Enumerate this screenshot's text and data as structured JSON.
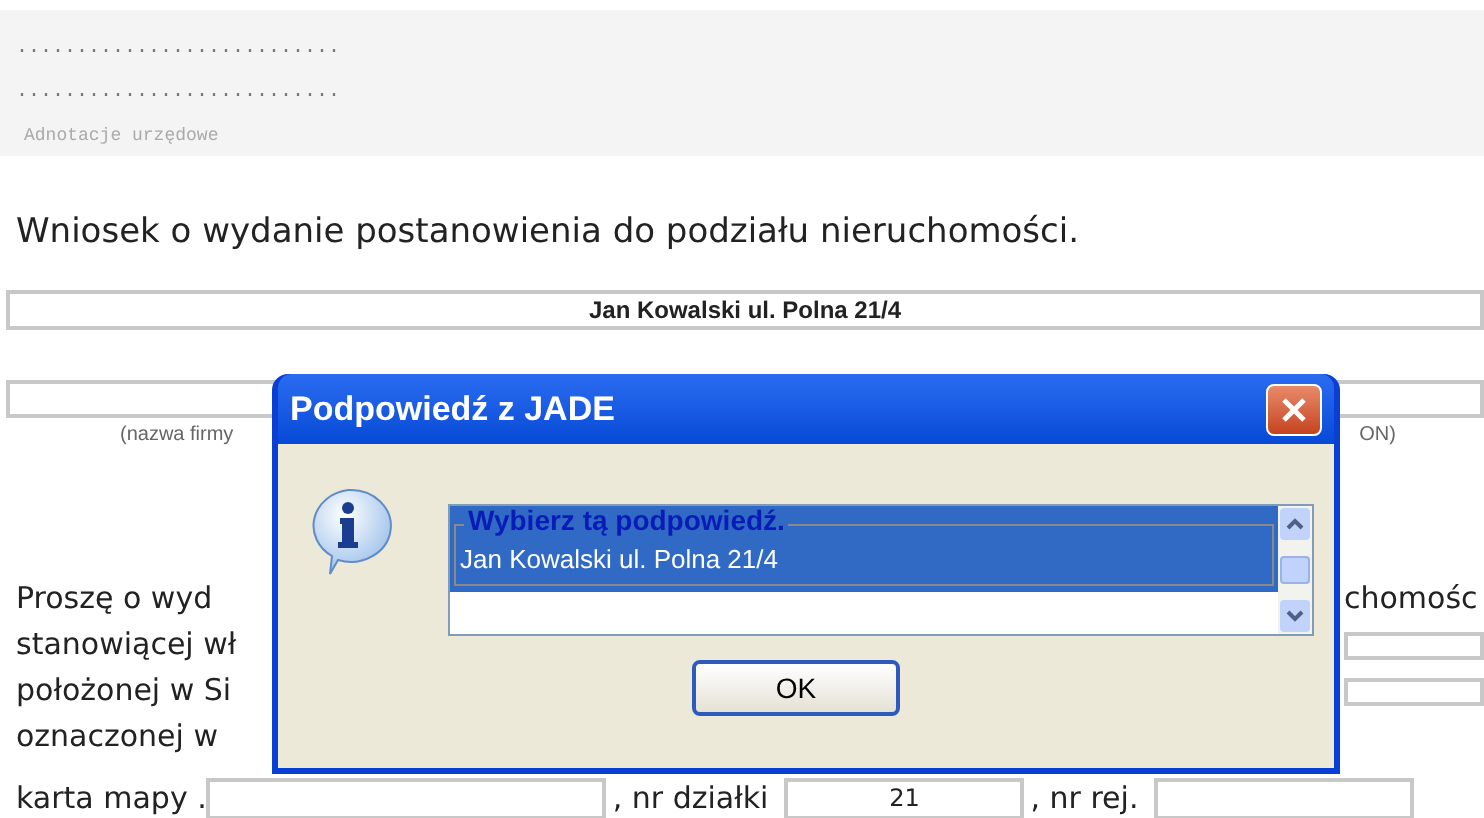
{
  "header": {
    "dotted_lines": [
      "...........................",
      "..........................."
    ],
    "caption": "Adnotacje urzędowe"
  },
  "title": "Wniosek o wydanie postanowienia do podziału nieruchomości.",
  "applicant_field": {
    "value": "Jan Kowalski ul. Polna 21/4"
  },
  "company_field": {
    "caption_left": "(nazwa firmy",
    "caption_right": "ON)"
  },
  "paragraph_lines": [
    {
      "left": "Proszę o wyd",
      "right": "chomośc"
    },
    {
      "left": "stanowiącej wł",
      "right_field": true
    },
    {
      "left": "położonej w Si",
      "right_field": true
    },
    {
      "left": "oznaczonej w",
      "right_field": false
    }
  ],
  "map_row": {
    "map_label": "karta mapy .",
    "plot_label": ", nr działki",
    "plot_number": "21",
    "register_label": ", nr rej."
  },
  "dialog": {
    "title": "Podpowiedź z JADE",
    "items": [
      {
        "legend": "Wybierz tą podpowiedź.",
        "text": "Jan Kowalski ul. Polna 21/4",
        "selected": true
      }
    ],
    "ok_button": "OK"
  }
}
